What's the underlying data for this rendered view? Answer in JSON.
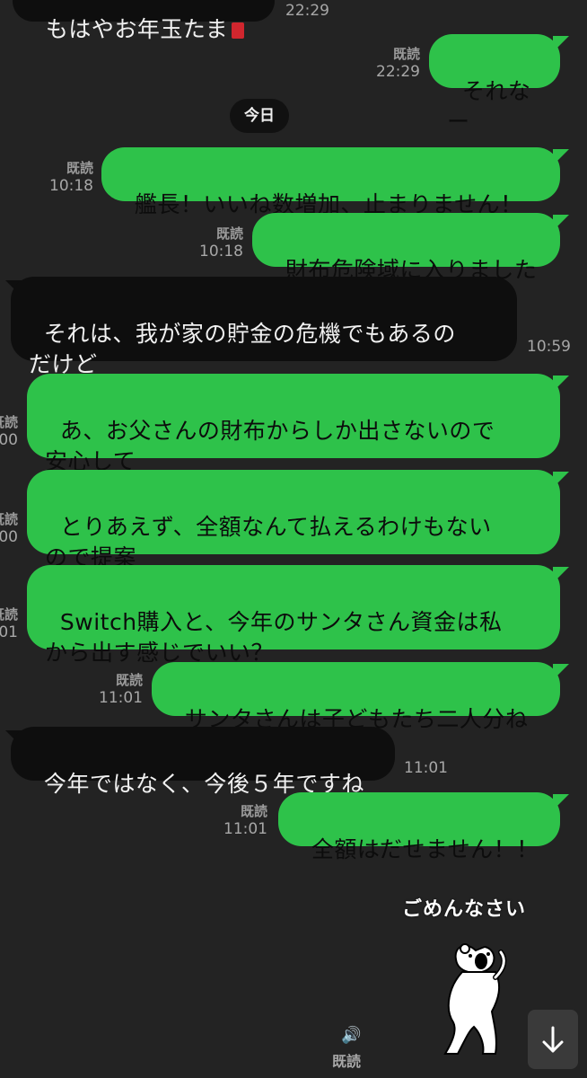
{
  "messages": {
    "m0_text": "もはやお年玉たま",
    "m0_time": "22:29",
    "m1_read": "既読",
    "m1_time": "22:29",
    "m1_text": "それなー",
    "date": "今日",
    "m2_read": "既読",
    "m2_time": "10:18",
    "m2_text": "艦長！いいね数増加、止まりません！",
    "m3_read": "既読",
    "m3_time": "10:18",
    "m3_text": "財布危険域に入りました",
    "m4_text": "それは、我が家の貯金の危機でもあるの\nだけど",
    "m4_time": "10:59",
    "m5_read": "既読",
    "m5_time": "00",
    "m5_text": "あ、お父さんの財布からしか出さないので\n安心して",
    "m6_read": "既読",
    "m6_time": "00",
    "m6_text": "とりあえず、全額なんて払えるわけもない\nので提案",
    "m7_read": "既読",
    "m7_time": "01",
    "m7_text": "Switch購入と、今年のサンタさん資金は私\nから出す感じでいい？",
    "m8_read": "既読",
    "m8_time": "11:01",
    "m8_text": "サンタさんは子どもたち二人分ね",
    "m9_text": "今年ではなく、今後５年ですね",
    "m9_time": "11:01",
    "m10_read": "既読",
    "m10_time": "11:01",
    "m10_text": "全額はだせません！！",
    "sticker_text": "ごめんなさい",
    "sticker_read": "既読"
  },
  "colors": {
    "background": "#232323",
    "my_bubble": "#2ec24a",
    "their_bubble": "#0e0e0e"
  },
  "icons": [
    "speaker-icon",
    "arrow-down-icon",
    "red-envelope-icon"
  ]
}
